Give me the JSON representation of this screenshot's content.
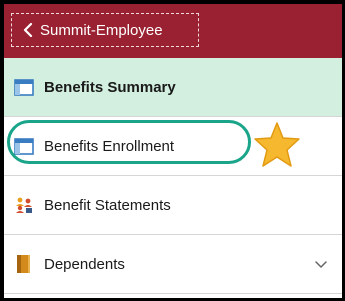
{
  "header": {
    "back_label": "Summit-Employee",
    "background": "#9a2131"
  },
  "nav": {
    "items": [
      {
        "label": "Benefits Summary",
        "icon": "page-list-icon",
        "active": true
      },
      {
        "label": "Benefits Enrollment",
        "icon": "page-list-icon",
        "active": false,
        "highlighted": true
      },
      {
        "label": "Benefit Statements",
        "icon": "people-statements-icon",
        "active": false
      },
      {
        "label": "Dependents",
        "icon": "book-icon",
        "active": false,
        "expandable": true
      }
    ]
  },
  "annotations": {
    "ring_color": "#1aa58a",
    "star_color": "#f5b82e",
    "star_icon": "star-icon"
  },
  "colors": {
    "active_bg": "#d3efe0",
    "icon_blue": "#3a7cc2"
  }
}
